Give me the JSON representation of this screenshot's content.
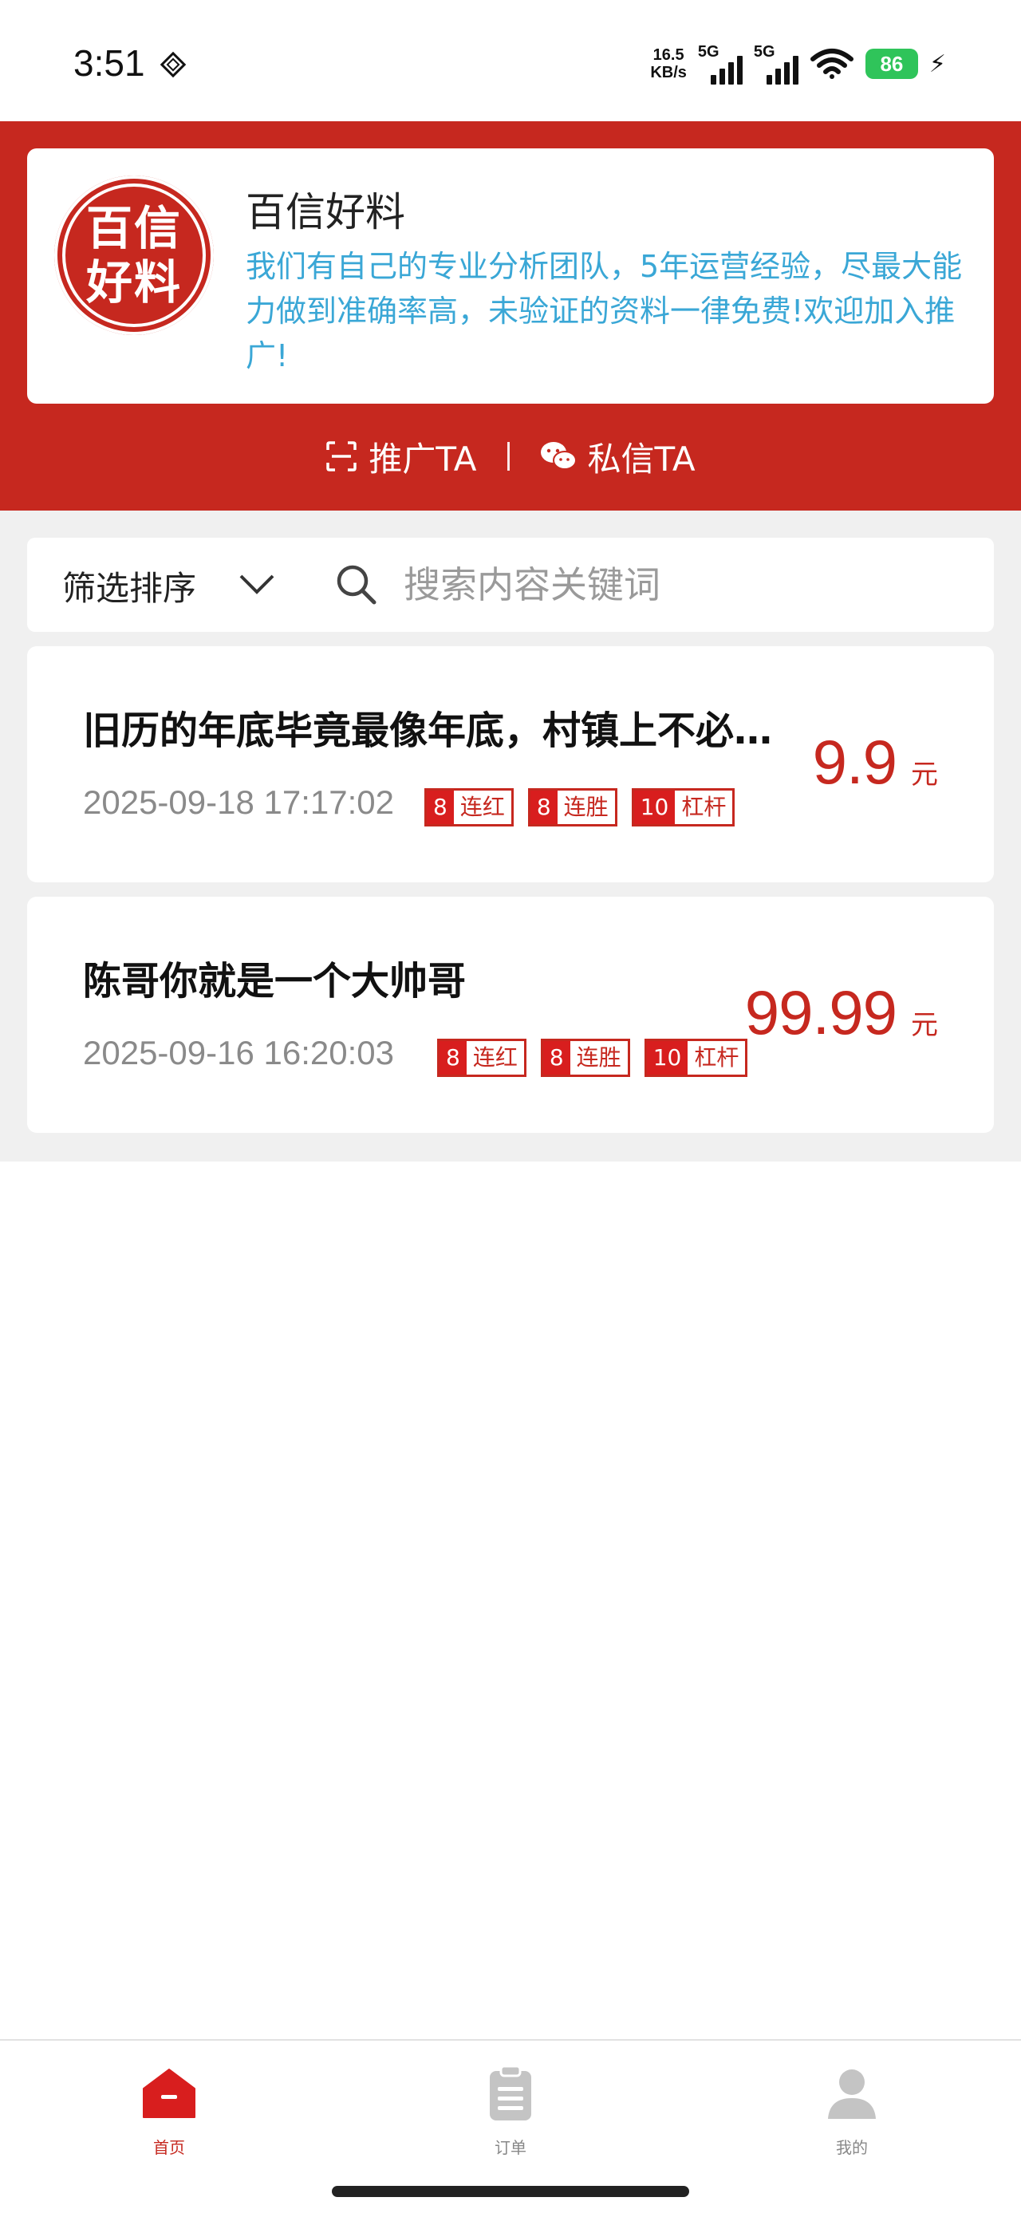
{
  "status_bar": {
    "time": "3:51",
    "net_speed_value": "16.5",
    "net_speed_unit": "KB/s",
    "signal1_label": "5G",
    "signal2_label": "5G",
    "battery": "86"
  },
  "profile": {
    "logo_line1": "百信",
    "logo_line2": "好料",
    "name": "百信好料",
    "description": "我们有自己的专业分析团队，5年运营经验，尽最大能力做到准确率高，未验证的资料一律免费!欢迎加入推广!"
  },
  "actions": {
    "promote_label": "推广TA",
    "message_label": "私信TA"
  },
  "filter": {
    "sort_label": "筛选排序",
    "search_placeholder": "搜索内容关键词"
  },
  "items": [
    {
      "title": "旧历的年底毕竟最像年底，村镇上不必…",
      "date": "2025-09-18 17:17:02",
      "tags": [
        {
          "num": "8",
          "label": "连红"
        },
        {
          "num": "8",
          "label": "连胜"
        },
        {
          "num": "10",
          "label": "杠杆"
        }
      ],
      "price": "9.9",
      "unit": "元"
    },
    {
      "title": "陈哥你就是一个大帅哥",
      "date": "2025-09-16 16:20:03",
      "tags": [
        {
          "num": "8",
          "label": "连红"
        },
        {
          "num": "8",
          "label": "连胜"
        },
        {
          "num": "10",
          "label": "杠杆"
        }
      ],
      "price": "99.99",
      "unit": "元"
    }
  ],
  "nav": {
    "home": "首页",
    "orders": "订单",
    "mine": "我的"
  },
  "colors": {
    "brand_red": "#c6281f",
    "desc_blue": "#3aa7d6",
    "battery_green": "#2fc45a"
  }
}
